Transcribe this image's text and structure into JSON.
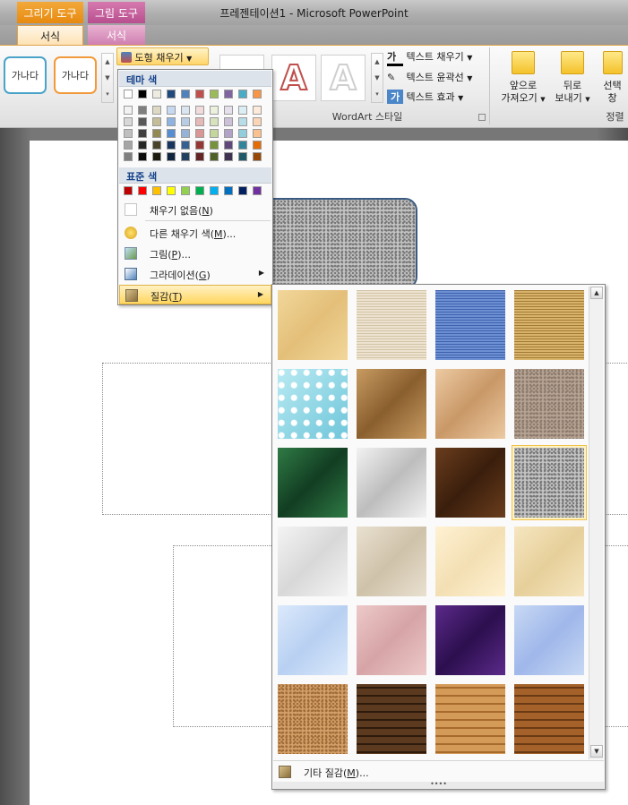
{
  "window": {
    "title": "프레젠테이션1 - Microsoft PowerPoint"
  },
  "context_tabs": {
    "drawing_tools": {
      "header": "그리기 도구",
      "tab": "서식"
    },
    "picture_tools": {
      "header": "그림 도구",
      "tab": "서식"
    }
  },
  "ribbon": {
    "shape_styles": [
      "가나다",
      "가나다"
    ],
    "shape_fill_label": "도형 채우기",
    "wordart": {
      "group_label": "WordArt 스타일",
      "letters": [
        "A",
        "A"
      ],
      "text_fill": "텍스트 채우기",
      "text_outline": "텍스트 윤곽선",
      "text_effects": "텍스트 효과",
      "fill_glyph": "가",
      "effects_glyph": "가"
    },
    "arrange": {
      "group_label": "정렬",
      "bring_forward": [
        "앞으로",
        "가져오기"
      ],
      "send_backward": [
        "뒤로",
        "보내기"
      ],
      "selection_pane": [
        "선택",
        "창"
      ]
    }
  },
  "fill_menu": {
    "theme_colors_header": "테마 색",
    "standard_colors_header": "표준 색",
    "no_fill": {
      "label": "채우기 없음",
      "key": "N"
    },
    "more_colors": {
      "label": "다른 채우기 색",
      "key": "M",
      "suffix": "..."
    },
    "picture": {
      "label": "그림",
      "key": "P",
      "suffix": "..."
    },
    "gradient": {
      "label": "그라데이션",
      "key": "G"
    },
    "texture": {
      "label": "질감",
      "key": "T"
    },
    "theme_colors": [
      "#ffffff",
      "#000000",
      "#eeece1",
      "#1f497d",
      "#4f81bd",
      "#c0504d",
      "#9bbb59",
      "#8064a2",
      "#4bacc6",
      "#f79646"
    ],
    "theme_shades": [
      [
        "#f2f2f2",
        "#7f7f7f",
        "#ddd9c3",
        "#c6d9f0",
        "#dbe5f1",
        "#f2dcdb",
        "#ebf1dd",
        "#e5e0ec",
        "#dbeef3",
        "#fdeada"
      ],
      [
        "#d8d8d8",
        "#595959",
        "#c4bd97",
        "#8db3e2",
        "#b8cce4",
        "#e5b9b7",
        "#d7e3bc",
        "#ccc1d9",
        "#b7dde8",
        "#fbd5b5"
      ],
      [
        "#bfbfbf",
        "#3f3f3f",
        "#938953",
        "#548dd4",
        "#95b3d7",
        "#d99694",
        "#c3d69b",
        "#b2a2c7",
        "#92cddc",
        "#fac08f"
      ],
      [
        "#a5a5a5",
        "#262626",
        "#494429",
        "#17365d",
        "#366092",
        "#953734",
        "#76923c",
        "#5f497a",
        "#31859b",
        "#e36c09"
      ],
      [
        "#7f7f7f",
        "#0c0c0c",
        "#1d1b10",
        "#0f243e",
        "#244061",
        "#632423",
        "#4f6128",
        "#3f3151",
        "#205867",
        "#974806"
      ]
    ],
    "standard_colors": [
      "#c00000",
      "#ff0000",
      "#ffc000",
      "#ffff00",
      "#92d050",
      "#00b050",
      "#00b0f0",
      "#0070c0",
      "#002060",
      "#7030a0"
    ]
  },
  "texture_panel": {
    "more_textures": {
      "label": "기타 질감",
      "key": "M",
      "suffix": "..."
    },
    "grip": "••••",
    "selected_index": 11,
    "textures": [
      {
        "name": "papyrus",
        "colors": [
          "#f2d79a",
          "#e3bf79"
        ]
      },
      {
        "name": "canvas",
        "colors": [
          "#ece2cf",
          "#d3c4a6"
        ]
      },
      {
        "name": "denim",
        "colors": [
          "#6d8fd3",
          "#3f62ad"
        ]
      },
      {
        "name": "woven-mat",
        "colors": [
          "#d8b36a",
          "#a37a36"
        ]
      },
      {
        "name": "water-droplets",
        "colors": [
          "#b9eaf2",
          "#6fc6da"
        ]
      },
      {
        "name": "paper-bag",
        "colors": [
          "#c89b62",
          "#8a5f2e"
        ]
      },
      {
        "name": "fish-fossil",
        "colors": [
          "#eccaa2",
          "#c99867"
        ]
      },
      {
        "name": "sand",
        "colors": [
          "#b6a393",
          "#8c7a6c"
        ]
      },
      {
        "name": "green-marble",
        "colors": [
          "#2f7a45",
          "#123d22"
        ]
      },
      {
        "name": "white-marble",
        "colors": [
          "#f2f2f2",
          "#bdbdbd"
        ]
      },
      {
        "name": "brown-marble",
        "colors": [
          "#6a3d1d",
          "#3a1e0c"
        ]
      },
      {
        "name": "granite",
        "colors": [
          "#c4c4c4",
          "#777777"
        ]
      },
      {
        "name": "newsprint",
        "colors": [
          "#f4f4f4",
          "#d8d8d8"
        ]
      },
      {
        "name": "recycled-paper",
        "colors": [
          "#e9e0d0",
          "#cfc2aa"
        ]
      },
      {
        "name": "parchment",
        "colors": [
          "#fff2d3",
          "#f3dfb3"
        ]
      },
      {
        "name": "stationery",
        "colors": [
          "#f6e6c0",
          "#e6cf9a"
        ]
      },
      {
        "name": "blue-tissue-paper",
        "colors": [
          "#dbe9fb",
          "#b8d0f2"
        ]
      },
      {
        "name": "pink-tissue-paper",
        "colors": [
          "#edc9c9",
          "#d6a4a6"
        ]
      },
      {
        "name": "purple-mesh",
        "colors": [
          "#5b2a8a",
          "#2c0f4e"
        ]
      },
      {
        "name": "bouquet",
        "colors": [
          "#c8d9f4",
          "#9fb7ea"
        ]
      },
      {
        "name": "cork",
        "colors": [
          "#d3a06a",
          "#9f6a37"
        ]
      },
      {
        "name": "walnut",
        "colors": [
          "#5c3a1f",
          "#2e1a0b"
        ]
      },
      {
        "name": "oak",
        "colors": [
          "#d49a58",
          "#a66b2d"
        ]
      },
      {
        "name": "medium-wood",
        "colors": [
          "#a4622a",
          "#6a3a14"
        ]
      }
    ]
  }
}
